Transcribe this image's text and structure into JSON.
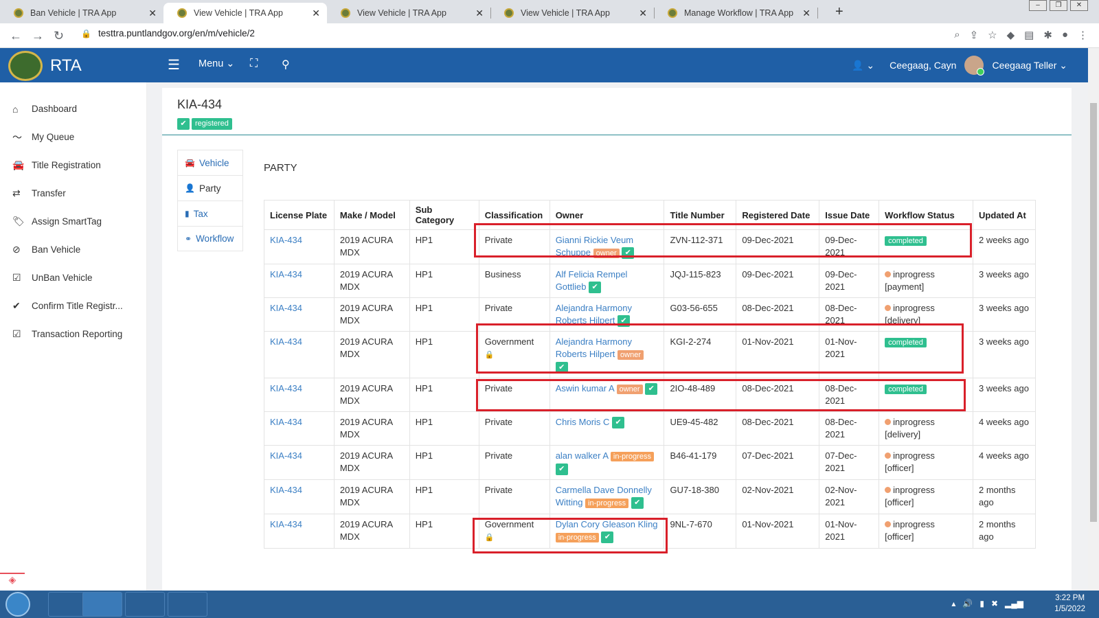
{
  "browser": {
    "tabs": [
      {
        "title": "Ban Vehicle | TRA App",
        "close": "✕"
      },
      {
        "title": "View Vehicle | TRA App",
        "close": "✕"
      },
      {
        "title": "View Vehicle | TRA App",
        "close": "✕"
      },
      {
        "title": "View Vehicle | TRA App",
        "close": "✕"
      },
      {
        "title": "Manage Workflow | TRA App",
        "close": "✕"
      }
    ],
    "new_tab": "+",
    "url": "testtra.puntlandgov.org/en/m/vehicle/2"
  },
  "header": {
    "brand": "RTA",
    "menu_label": "Menu",
    "user_name": "Ceegaag, Cayn",
    "profile_name": "Ceegaag Teller"
  },
  "sidebar": {
    "items": [
      {
        "label": "Dashboard",
        "icon": "home-icon"
      },
      {
        "label": "My Queue",
        "icon": "chart-line-icon"
      },
      {
        "label": "Title Registration",
        "icon": "car-icon"
      },
      {
        "label": "Transfer",
        "icon": "exchange-icon"
      },
      {
        "label": "Assign SmartTag",
        "icon": "tags-icon"
      },
      {
        "label": "Ban Vehicle",
        "icon": "ban-icon"
      },
      {
        "label": "UnBan Vehicle",
        "icon": "check-square-icon"
      },
      {
        "label": "Confirm Title Registr...",
        "icon": "check-icon"
      },
      {
        "label": "Transaction Reporting",
        "icon": "check-square-icon"
      }
    ]
  },
  "vehicle": {
    "plate": "KIA-434",
    "status": "registered"
  },
  "vtabs": [
    {
      "label": "Vehicle",
      "icon": "car-icon"
    },
    {
      "label": "Party",
      "icon": "user-icon"
    },
    {
      "label": "Tax",
      "icon": "file-icon"
    },
    {
      "label": "Workflow",
      "icon": "link-icon"
    }
  ],
  "section_title": "PARTY",
  "table": {
    "headers": [
      "License Plate",
      "Make / Model",
      "Sub Category",
      "Classification",
      "Owner",
      "Title Number",
      "Registered Date",
      "Issue Date",
      "Workflow Status",
      "Updated At"
    ],
    "rows": [
      {
        "plate": "KIA-434",
        "model": "2019 ACURA MDX",
        "sub": "HP1",
        "class": "Private",
        "owner": "Gianni Rickie Veum Schuppe",
        "tag": "owner",
        "title": "ZVN-112-371",
        "reg": "09-Dec-2021",
        "issue": "09-Dec-2021",
        "status": "completed",
        "step": "",
        "updated": "2 weeks ago"
      },
      {
        "plate": "KIA-434",
        "model": "2019 ACURA MDX",
        "sub": "HP1",
        "class": "Business",
        "owner": "Alf Felicia Rempel Gottlieb",
        "tag": "",
        "title": "JQJ-115-823",
        "reg": "09-Dec-2021",
        "issue": "09-Dec-2021",
        "status": "inprogress",
        "step": "[payment]",
        "updated": "3 weeks ago"
      },
      {
        "plate": "KIA-434",
        "model": "2019 ACURA MDX",
        "sub": "HP1",
        "class": "Private",
        "owner": "Alejandra Harmony Roberts Hilpert",
        "tag": "",
        "title": "G03-56-655",
        "reg": "08-Dec-2021",
        "issue": "08-Dec-2021",
        "status": "inprogress",
        "step": "[delivery]",
        "updated": "3 weeks ago"
      },
      {
        "plate": "KIA-434",
        "model": "2019 ACURA MDX",
        "sub": "HP1",
        "class": "Government",
        "owner": "Alejandra Harmony Roberts Hilpert",
        "tag": "owner",
        "title": "KGI-2-274",
        "reg": "01-Nov-2021",
        "issue": "01-Nov-2021",
        "status": "completed",
        "step": "",
        "updated": "3 weeks ago"
      },
      {
        "plate": "KIA-434",
        "model": "2019 ACURA MDX",
        "sub": "HP1",
        "class": "Private",
        "owner": "Aswin kumar A",
        "tag": "owner",
        "title": "2IO-48-489",
        "reg": "08-Dec-2021",
        "issue": "08-Dec-2021",
        "status": "completed",
        "step": "",
        "updated": "3 weeks ago"
      },
      {
        "plate": "KIA-434",
        "model": "2019 ACURA MDX",
        "sub": "HP1",
        "class": "Private",
        "owner": "Chris Moris C",
        "tag": "",
        "title": "UE9-45-482",
        "reg": "08-Dec-2021",
        "issue": "08-Dec-2021",
        "status": "inprogress",
        "step": "[delivery]",
        "updated": "4 weeks ago"
      },
      {
        "plate": "KIA-434",
        "model": "2019 ACURA MDX",
        "sub": "HP1",
        "class": "Private",
        "owner": "alan walker A",
        "tag": "in-progress",
        "title": "B46-41-179",
        "reg": "07-Dec-2021",
        "issue": "07-Dec-2021",
        "status": "inprogress",
        "step": "[officer]",
        "updated": "4 weeks ago"
      },
      {
        "plate": "KIA-434",
        "model": "2019 ACURA MDX",
        "sub": "HP1",
        "class": "Private",
        "owner": "Carmella Dave Donnelly Witting",
        "tag": "in-progress",
        "title": "GU7-18-380",
        "reg": "02-Nov-2021",
        "issue": "02-Nov-2021",
        "status": "inprogress",
        "step": "[officer]",
        "updated": "2 months ago"
      },
      {
        "plate": "KIA-434",
        "model": "2019 ACURA MDX",
        "sub": "HP1",
        "class": "Government",
        "owner": "Dylan Cory Gleason Kling",
        "tag": "in-progress",
        "title": "9NL-7-670",
        "reg": "01-Nov-2021",
        "issue": "01-Nov-2021",
        "status": "inprogress",
        "step": "[officer]",
        "updated": "2 months ago"
      }
    ]
  },
  "taskbar": {
    "time": "3:22 PM",
    "date": "1/5/2022"
  },
  "colors": {
    "header": "#1f5fa6",
    "accent_green": "#2fbf8f",
    "badge_orange": "#f0a070",
    "highlight_red": "#d9202a"
  }
}
